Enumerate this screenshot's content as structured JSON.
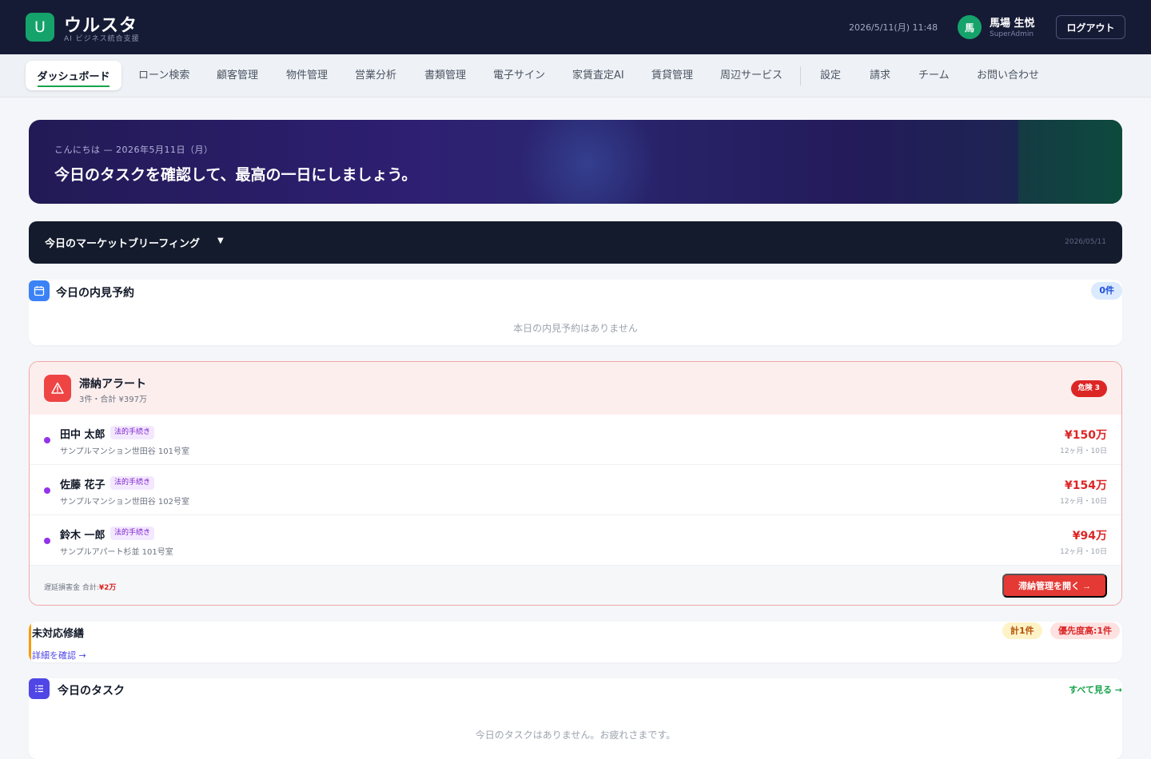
{
  "header": {
    "logo_letter": "U",
    "brand_name": "ウルスタ",
    "brand_sub": "AI ビジネス統合支援",
    "datetime": "2026/5/11(月) 11:48",
    "user_initial": "馬",
    "user_name": "馬場 生悦",
    "user_role": "SuperAdmin",
    "logout_label": "ログアウト"
  },
  "nav": {
    "active": "ダッシュボード",
    "items": [
      "ローン検索",
      "顧客管理",
      "物件管理",
      "営業分析",
      "書類管理",
      "電子サイン",
      "家賃査定AI",
      "賃貸管理",
      "周辺サービス",
      "設定",
      "請求",
      "チーム",
      "お問い合わせ"
    ]
  },
  "hero": {
    "greeting": "こんにちは — 2026年5月11日（月）",
    "title": "今日のタスクを確認して、最高の一日にしましょう。"
  },
  "briefing": {
    "title": "今日のマーケットブリーフィング",
    "arrow": "▼",
    "date": "2026/05/11"
  },
  "viewing": {
    "title": "今日の内見予約",
    "count": "0件",
    "empty": "本日の内見予約はありません"
  },
  "arrears": {
    "title": "滞納アラート",
    "summary": "3件・合計 ¥397万",
    "danger_badge": "危険 3",
    "rows": [
      {
        "name": "田中 太郎",
        "tag": "法的手続き",
        "property": "サンプルマンション世田谷 101号室",
        "amount": "¥150万",
        "meta": "12ヶ月・10日"
      },
      {
        "name": "佐藤 花子",
        "tag": "法的手続き",
        "property": "サンプルマンション世田谷 102号室",
        "amount": "¥154万",
        "meta": "12ヶ月・10日"
      },
      {
        "name": "鈴木 一郎",
        "tag": "法的手続き",
        "property": "サンプルアパート杉並 101号室",
        "amount": "¥94万",
        "meta": "12ヶ月・10日"
      }
    ],
    "late_fee_label": "遅延損害金 合計:",
    "late_fee_value": "¥2万",
    "open_button": "滞納管理を開く →"
  },
  "repairs": {
    "title": "未対応修繕",
    "link": "詳細を確認 →",
    "total": "計1件",
    "high_priority": "優先度高:1件"
  },
  "tasks": {
    "title": "今日のタスク",
    "see_all": "すべて見る →",
    "empty": "今日のタスクはありません。お疲れさまです。"
  },
  "colors": {
    "header_bg": "#161b35",
    "brand_green": "#15a36b",
    "danger_red": "#dc2626",
    "link_indigo": "#4f46e5"
  },
  "icons": {
    "viewing": "calendar-icon",
    "arrears": "alert-triangle-icon",
    "tasks": "list-icon"
  }
}
